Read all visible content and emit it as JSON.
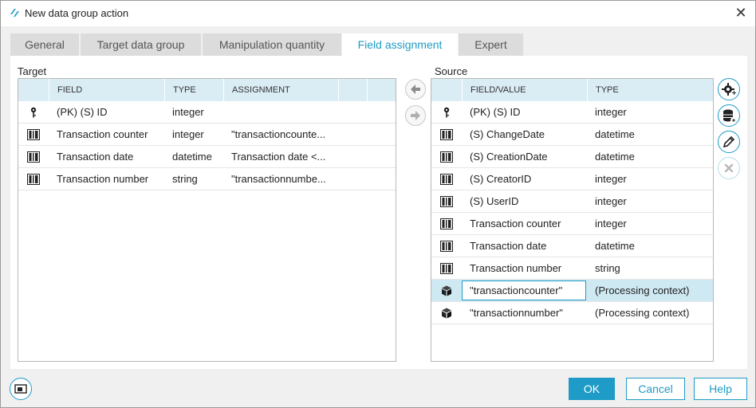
{
  "window": {
    "title": "New data group action"
  },
  "tabs": [
    {
      "label": "General"
    },
    {
      "label": "Target data group"
    },
    {
      "label": "Manipulation quantity"
    },
    {
      "label": "Field assignment"
    },
    {
      "label": "Expert"
    }
  ],
  "active_tab": "Field assignment",
  "target": {
    "label": "Target",
    "columns": {
      "field": "FIELD",
      "type": "TYPE",
      "assignment": "ASSIGNMENT"
    },
    "rows": [
      {
        "icon": "key-icon",
        "field": "(PK) (S) ID",
        "type": "integer",
        "assignment": ""
      },
      {
        "icon": "field-icon",
        "field": "Transaction counter",
        "type": "integer",
        "assignment": "\"transactioncounte..."
      },
      {
        "icon": "field-icon",
        "field": "Transaction date",
        "type": "datetime",
        "assignment": "Transaction date <..."
      },
      {
        "icon": "field-icon",
        "field": "Transaction number",
        "type": "string",
        "assignment": "\"transactionnumbe..."
      }
    ]
  },
  "source": {
    "label": "Source",
    "columns": {
      "field": "FIELD/VALUE",
      "type": "TYPE"
    },
    "rows": [
      {
        "icon": "key-icon",
        "field": "(PK) (S) ID",
        "type": "integer"
      },
      {
        "icon": "field-icon",
        "field": "(S) ChangeDate",
        "type": "datetime"
      },
      {
        "icon": "field-icon",
        "field": "(S) CreationDate",
        "type": "datetime"
      },
      {
        "icon": "field-icon",
        "field": "(S) CreatorID",
        "type": "integer"
      },
      {
        "icon": "field-icon",
        "field": "(S) UserID",
        "type": "integer"
      },
      {
        "icon": "field-icon",
        "field": "Transaction counter",
        "type": "integer"
      },
      {
        "icon": "field-icon",
        "field": "Transaction date",
        "type": "datetime"
      },
      {
        "icon": "field-icon",
        "field": "Transaction number",
        "type": "string"
      },
      {
        "icon": "cube-icon",
        "field": "\"transactioncounter\"",
        "type": "(Processing context)",
        "selected": true
      },
      {
        "icon": "cube-icon",
        "field": "\"transactionnumber\"",
        "type": "(Processing context)"
      }
    ]
  },
  "side_buttons": [
    {
      "icon": "gear-add-icon"
    },
    {
      "icon": "database-add-icon"
    },
    {
      "icon": "pencil-icon"
    },
    {
      "icon": "delete-x-icon",
      "disabled": true
    }
  ],
  "footer": {
    "ok": "OK",
    "cancel": "Cancel",
    "help": "Help"
  },
  "colors": {
    "accent": "#1e9bc6",
    "header_bg": "#daecf4",
    "selection_bg": "#cfe9f3"
  }
}
